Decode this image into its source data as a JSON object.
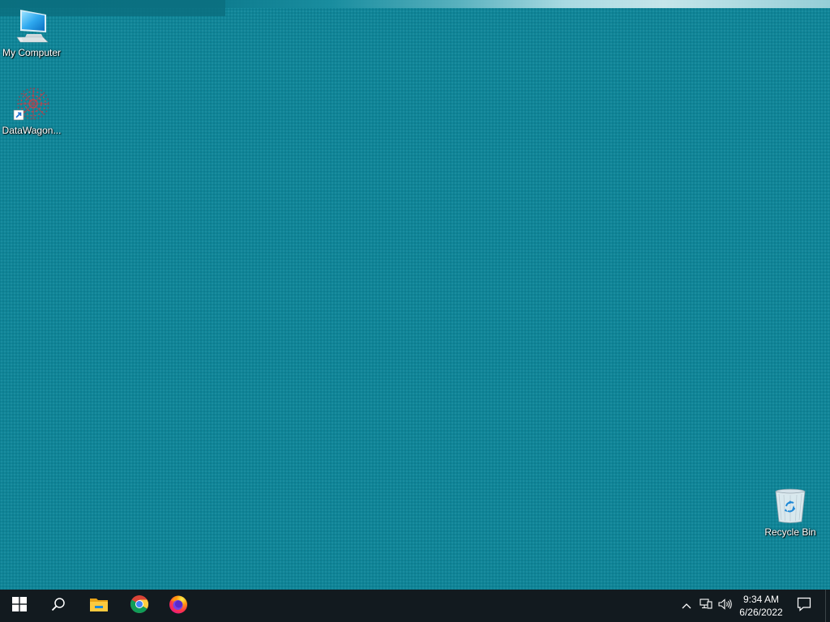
{
  "desktop": {
    "background_color": "#0f8598",
    "icons": [
      {
        "label": "My Computer",
        "icon": "computer-icon"
      },
      {
        "label": "DataWagon...",
        "icon": "datawagon-shortcut-icon",
        "shortcut": true
      },
      {
        "label": "Recycle Bin",
        "icon": "recycle-bin-icon"
      }
    ]
  },
  "taskbar": {
    "background_color": "#121a1f",
    "start_button": {
      "icon": "windows-logo-icon"
    },
    "search_button": {
      "icon": "search-icon"
    },
    "pinned_apps": [
      {
        "name": "File Explorer",
        "icon": "folder-icon"
      },
      {
        "name": "Google Chrome",
        "icon": "chrome-icon"
      },
      {
        "name": "Firefox",
        "icon": "firefox-icon"
      }
    ],
    "tray": {
      "chevron_icon": "chevron-up-icon",
      "network_icon": "network-icon",
      "volume_icon": "volume-icon",
      "notification_icon": "notification-icon",
      "clock": {
        "time": "9:34 AM",
        "date": "6/26/2022"
      }
    }
  }
}
